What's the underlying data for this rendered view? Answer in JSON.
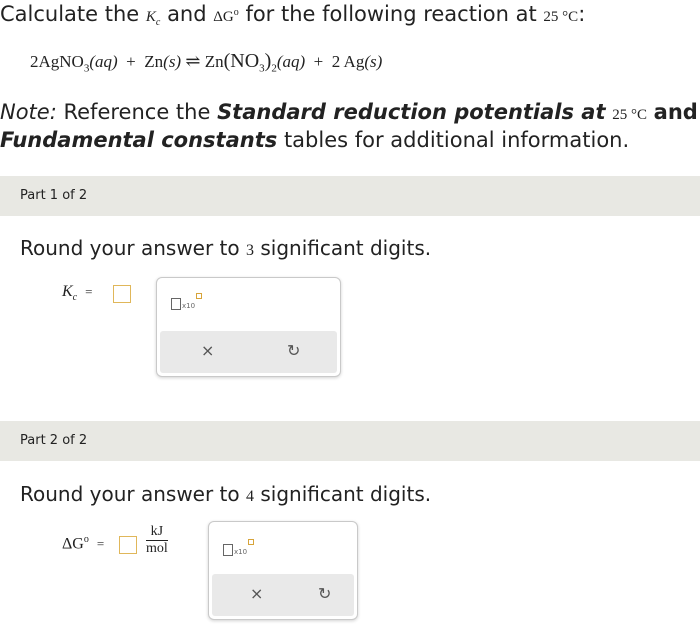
{
  "question": {
    "prefix": "Calculate the",
    "kc": "K",
    "kc_sub": "c",
    "and": "and",
    "dg": "ΔG",
    "deg": "o",
    "suffix": "for the following reaction at",
    "temp": "25 °C",
    "colon": ":"
  },
  "equation": {
    "left": "2AgNO",
    "left_sub": "3",
    "left_state": "(aq)",
    "plus1": "+",
    "zn": "Zn",
    "zn_state": "(s)",
    "arrow": "⇌",
    "product": "Zn",
    "product_inner": "(NO",
    "product_inner_sub": "3",
    "product_close": ")",
    "product_sub": "2",
    "product_state": "(aq)",
    "plus2": "+",
    "ag": "2 Ag",
    "ag_state": "(s)"
  },
  "note": {
    "label": "Note:",
    "ref": "Reference the",
    "bold1": "Standard reduction potentials at",
    "temp": "25 °C",
    "and": "and",
    "bold2": "Fundamental constants",
    "tail": "tables for additional information."
  },
  "part1": {
    "header": "Part 1 of 2",
    "instruction_pre": "Round your answer to",
    "digits": "3",
    "instruction_post": "significant digits.",
    "var": "K",
    "var_sub": "c",
    "equals": "=",
    "x10": "x10",
    "clear_icon": "×",
    "undo_icon": "↻"
  },
  "part2": {
    "header": "Part 2 of 2",
    "instruction_pre": "Round your answer to",
    "digits": "4",
    "instruction_post": "significant digits.",
    "var": "ΔG",
    "var_sup": "o",
    "equals": "=",
    "unit_num": "kJ",
    "unit_den": "mol",
    "x10": "x10",
    "clear_icon": "×",
    "undo_icon": "↻"
  }
}
